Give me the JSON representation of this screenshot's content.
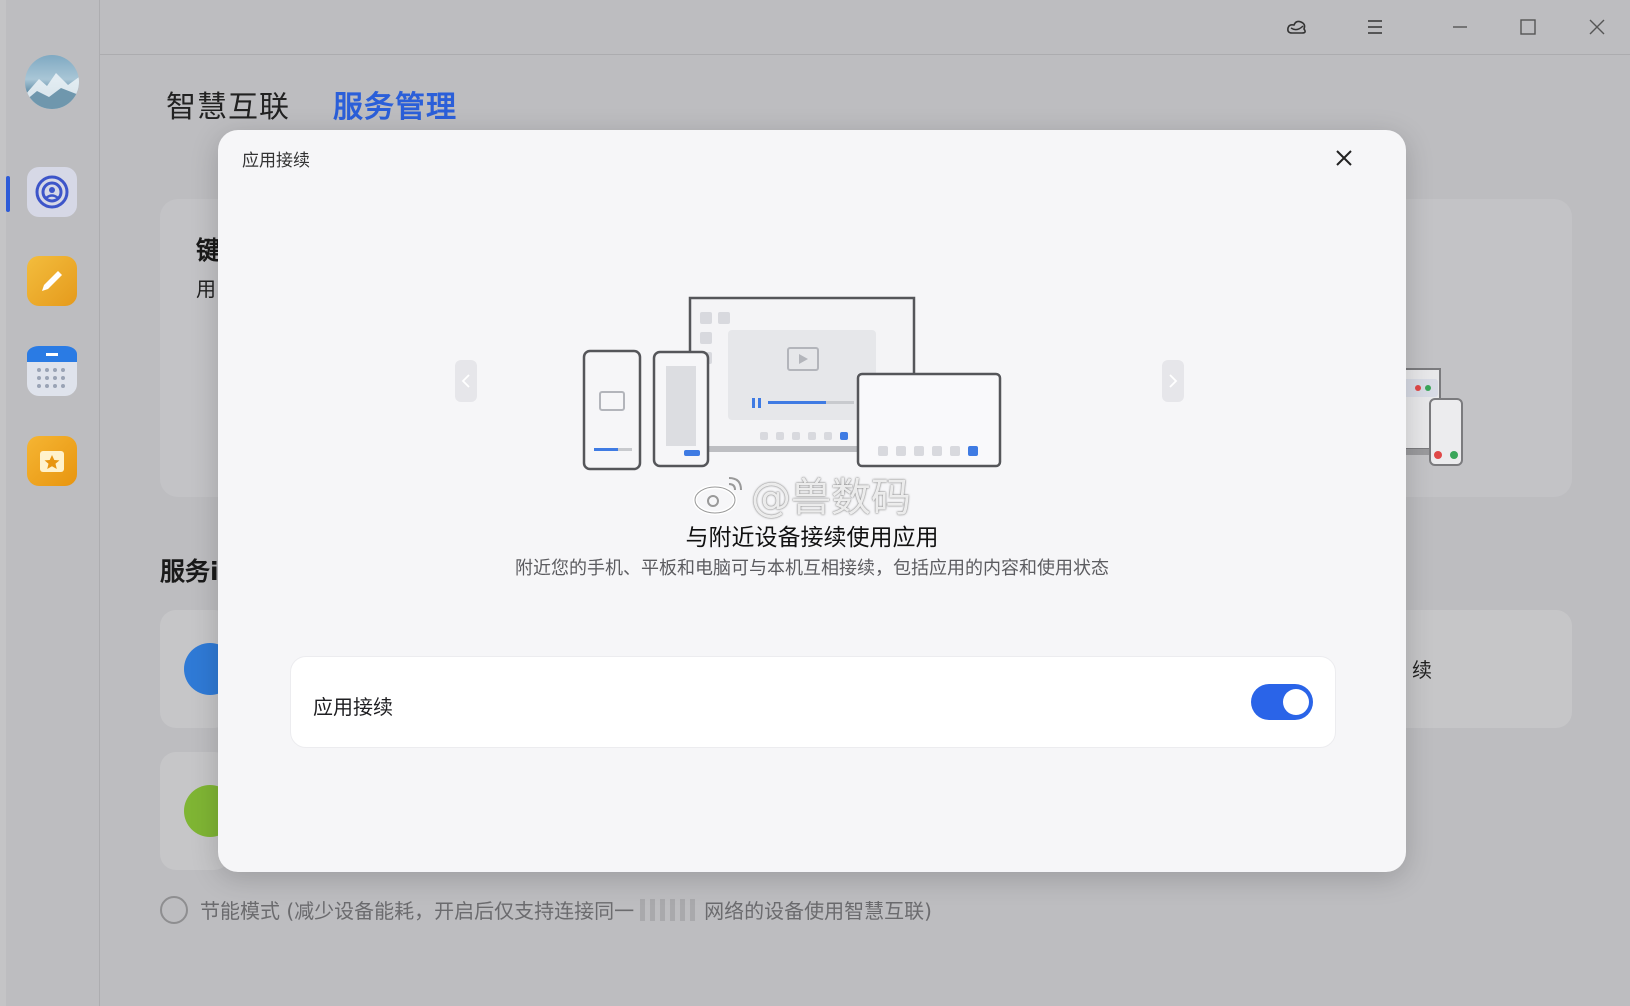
{
  "window": {
    "buttons": [
      "cloud-icon",
      "menu-icon",
      "minimize-icon",
      "maximize-icon",
      "close-icon"
    ]
  },
  "tabs": [
    {
      "label": "智慧互联",
      "active": false
    },
    {
      "label": "服务管理",
      "active": true
    }
  ],
  "background": {
    "card_left_title": "键",
    "card_left_sub": "用",
    "section_title": "服务i",
    "right_row_text": "续",
    "power_saving_label": "节能模式 (减少设备能耗，开启后仅支持连接同一",
    "power_saving_label_end": "网络的设备使用智慧互联)"
  },
  "sidebar": {
    "items": [
      {
        "icon": "avatar",
        "active": false
      },
      {
        "icon": "connect-icon",
        "active": true
      },
      {
        "icon": "notes-icon",
        "active": false
      },
      {
        "icon": "calendar-icon",
        "active": false
      },
      {
        "icon": "favorites-icon",
        "active": false
      }
    ]
  },
  "dialog": {
    "title": "应用接续",
    "headline": "与附近设备接续使用应用",
    "description": "附近您的手机、平板和电脑可与本机互相接续，包括应用的内容和使用状态",
    "setting": {
      "label": "应用接续",
      "enabled": true
    }
  },
  "watermark": "@兽数码",
  "colors": {
    "accent": "#2a64e8",
    "active_tab": "#2b5fd9",
    "dialog_bg": "#f6f6f8"
  }
}
